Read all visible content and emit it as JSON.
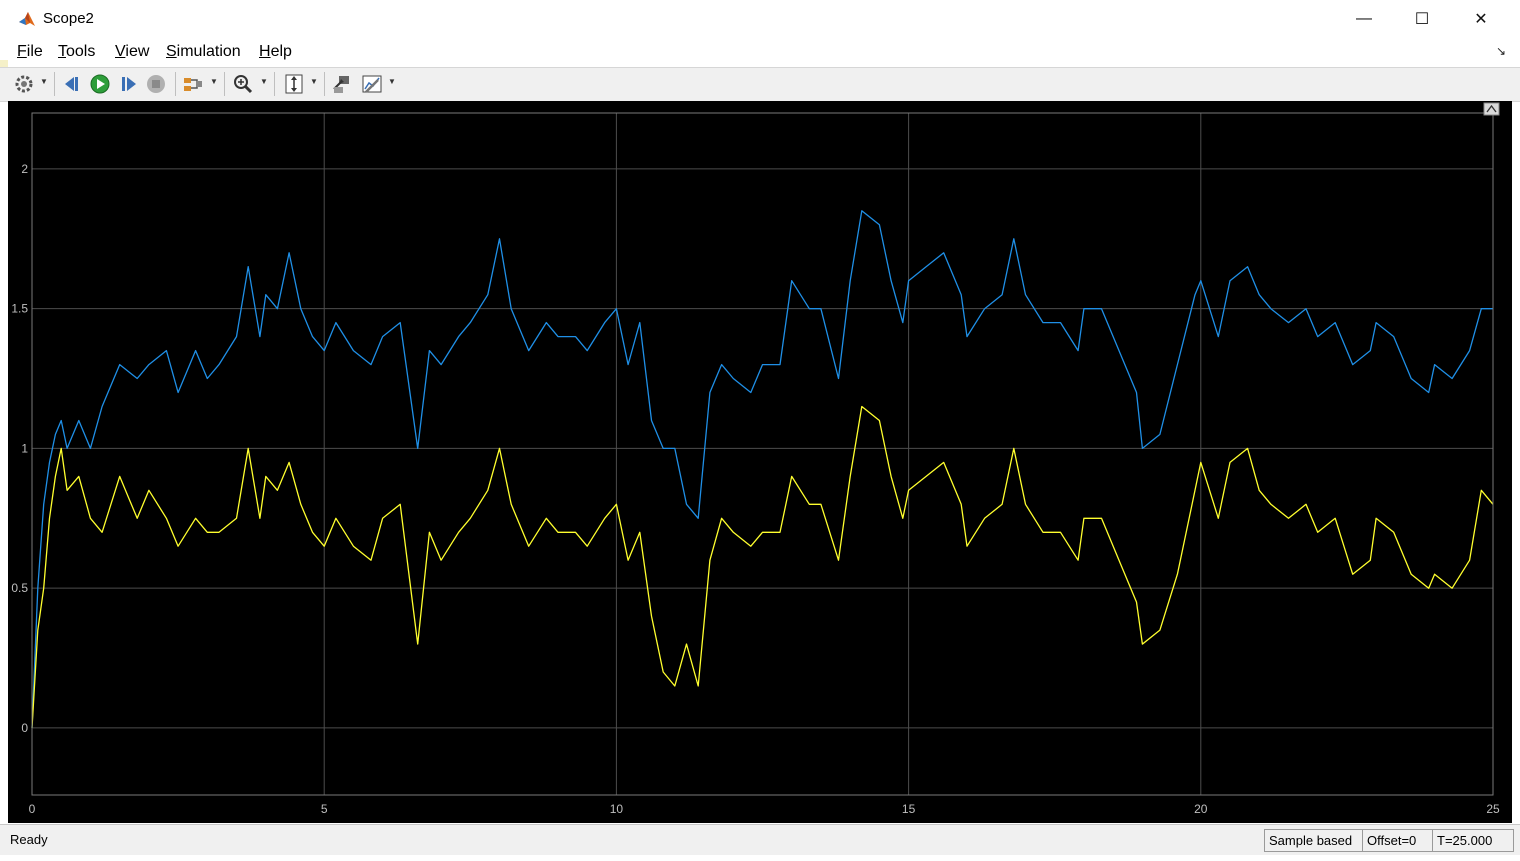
{
  "window": {
    "title": "Scope2",
    "minimize_glyph": "—",
    "maximize_glyph": "☐",
    "close_glyph": "✕"
  },
  "menu": [
    {
      "label": "File",
      "mnemonic": "F",
      "rest": "ile"
    },
    {
      "label": "Tools",
      "mnemonic": "T",
      "rest": "ools"
    },
    {
      "label": "View",
      "mnemonic": "V",
      "rest": "iew"
    },
    {
      "label": "Simulation",
      "mnemonic": "S",
      "rest": "imulation"
    },
    {
      "label": "Help",
      "mnemonic": "H",
      "rest": "elp"
    }
  ],
  "toolbar": {
    "items": [
      "settings-icon",
      "step-back-icon",
      "run-icon",
      "step-forward-icon",
      "stop-icon",
      "signal-select-icon",
      "zoom-in-icon",
      "autoscale-icon",
      "highlight-block-icon",
      "style-edit-icon"
    ]
  },
  "colors": {
    "plot_bg": "#000000",
    "axes_bg": "#000000",
    "grid": "#4d4d4d",
    "tick_text": "#bfbfbf",
    "series1": "#1f8fe6",
    "series2": "#ffff2e"
  },
  "chart_data": {
    "type": "line",
    "title": "",
    "xlabel": "",
    "ylabel": "",
    "xlim": [
      0,
      25
    ],
    "ylim": [
      -0.24,
      2.2
    ],
    "xticks": [
      "0",
      "5",
      "10",
      "15",
      "20",
      "25"
    ],
    "yticks": [
      "0",
      "0.5",
      "1",
      "1.5",
      "2"
    ],
    "grid": true,
    "series": [
      {
        "color": "#1f8fe6",
        "x": [
          0,
          0.1,
          0.2,
          0.3,
          0.4,
          0.5,
          0.6,
          0.8,
          1.0,
          1.2,
          1.5,
          1.8,
          2.0,
          2.3,
          2.5,
          2.8,
          3.0,
          3.2,
          3.5,
          3.7,
          3.9,
          4.0,
          4.2,
          4.4,
          4.6,
          4.8,
          5.0,
          5.2,
          5.5,
          5.8,
          6.0,
          6.3,
          6.6,
          6.8,
          7.0,
          7.3,
          7.5,
          7.8,
          8.0,
          8.2,
          8.5,
          8.8,
          9.0,
          9.3,
          9.5,
          9.8,
          10.0,
          10.2,
          10.4,
          10.6,
          10.8,
          11.0,
          11.2,
          11.4,
          11.6,
          11.8,
          12.0,
          12.3,
          12.5,
          12.8,
          13.0,
          13.3,
          13.5,
          13.8,
          14.0,
          14.2,
          14.5,
          14.7,
          14.9,
          15.0,
          15.3,
          15.6,
          15.9,
          16.0,
          16.3,
          16.6,
          16.8,
          17.0,
          17.3,
          17.6,
          17.9,
          18.0,
          18.3,
          18.6,
          18.9,
          19.0,
          19.3,
          19.6,
          19.9,
          20.0,
          20.3,
          20.5,
          20.8,
          21.0,
          21.2,
          21.5,
          21.8,
          22.0,
          22.3,
          22.6,
          22.9,
          23.0,
          23.3,
          23.6,
          23.9,
          24.0,
          24.3,
          24.6,
          24.8,
          25.0
        ],
        "y": [
          0.0,
          0.5,
          0.8,
          0.95,
          1.05,
          1.1,
          1.0,
          1.1,
          1.0,
          1.15,
          1.3,
          1.25,
          1.3,
          1.35,
          1.2,
          1.35,
          1.25,
          1.3,
          1.4,
          1.65,
          1.4,
          1.55,
          1.5,
          1.7,
          1.5,
          1.4,
          1.35,
          1.45,
          1.35,
          1.3,
          1.4,
          1.45,
          1.0,
          1.35,
          1.3,
          1.4,
          1.45,
          1.55,
          1.75,
          1.5,
          1.35,
          1.45,
          1.4,
          1.4,
          1.35,
          1.45,
          1.5,
          1.3,
          1.45,
          1.1,
          1.0,
          1.0,
          0.8,
          0.75,
          1.2,
          1.3,
          1.25,
          1.2,
          1.3,
          1.3,
          1.6,
          1.5,
          1.5,
          1.25,
          1.6,
          1.85,
          1.8,
          1.6,
          1.45,
          1.6,
          1.65,
          1.7,
          1.55,
          1.4,
          1.5,
          1.55,
          1.75,
          1.55,
          1.45,
          1.45,
          1.35,
          1.5,
          1.5,
          1.35,
          1.2,
          1.0,
          1.05,
          1.3,
          1.55,
          1.6,
          1.4,
          1.6,
          1.65,
          1.55,
          1.5,
          1.45,
          1.5,
          1.4,
          1.45,
          1.3,
          1.35,
          1.45,
          1.4,
          1.25,
          1.2,
          1.3,
          1.25,
          1.35,
          1.5,
          1.5
        ]
      },
      {
        "color": "#ffff2e",
        "x": [
          0,
          0.1,
          0.2,
          0.3,
          0.4,
          0.5,
          0.6,
          0.8,
          1.0,
          1.2,
          1.5,
          1.8,
          2.0,
          2.3,
          2.5,
          2.8,
          3.0,
          3.2,
          3.5,
          3.7,
          3.9,
          4.0,
          4.2,
          4.4,
          4.6,
          4.8,
          5.0,
          5.2,
          5.5,
          5.8,
          6.0,
          6.3,
          6.6,
          6.8,
          7.0,
          7.3,
          7.5,
          7.8,
          8.0,
          8.2,
          8.5,
          8.8,
          9.0,
          9.3,
          9.5,
          9.8,
          10.0,
          10.2,
          10.4,
          10.6,
          10.8,
          11.0,
          11.2,
          11.4,
          11.6,
          11.8,
          12.0,
          12.3,
          12.5,
          12.8,
          13.0,
          13.3,
          13.5,
          13.8,
          14.0,
          14.2,
          14.5,
          14.7,
          14.9,
          15.0,
          15.3,
          15.6,
          15.9,
          16.0,
          16.3,
          16.6,
          16.8,
          17.0,
          17.3,
          17.6,
          17.9,
          18.0,
          18.3,
          18.6,
          18.9,
          19.0,
          19.3,
          19.6,
          19.9,
          20.0,
          20.3,
          20.5,
          20.8,
          21.0,
          21.2,
          21.5,
          21.8,
          22.0,
          22.3,
          22.6,
          22.9,
          23.0,
          23.3,
          23.6,
          23.9,
          24.0,
          24.3,
          24.6,
          24.8,
          25.0
        ],
        "y": [
          0.0,
          0.35,
          0.5,
          0.75,
          0.9,
          1.0,
          0.85,
          0.9,
          0.75,
          0.7,
          0.9,
          0.75,
          0.85,
          0.75,
          0.65,
          0.75,
          0.7,
          0.7,
          0.75,
          1.0,
          0.75,
          0.9,
          0.85,
          0.95,
          0.8,
          0.7,
          0.65,
          0.75,
          0.65,
          0.6,
          0.75,
          0.8,
          0.3,
          0.7,
          0.6,
          0.7,
          0.75,
          0.85,
          1.0,
          0.8,
          0.65,
          0.75,
          0.7,
          0.7,
          0.65,
          0.75,
          0.8,
          0.6,
          0.7,
          0.4,
          0.2,
          0.15,
          0.3,
          0.15,
          0.6,
          0.75,
          0.7,
          0.65,
          0.7,
          0.7,
          0.9,
          0.8,
          0.8,
          0.6,
          0.9,
          1.15,
          1.1,
          0.9,
          0.75,
          0.85,
          0.9,
          0.95,
          0.8,
          0.65,
          0.75,
          0.8,
          1.0,
          0.8,
          0.7,
          0.7,
          0.6,
          0.75,
          0.75,
          0.6,
          0.45,
          0.3,
          0.35,
          0.55,
          0.85,
          0.95,
          0.75,
          0.95,
          1.0,
          0.85,
          0.8,
          0.75,
          0.8,
          0.7,
          0.75,
          0.55,
          0.6,
          0.75,
          0.7,
          0.55,
          0.5,
          0.55,
          0.5,
          0.6,
          0.85,
          0.8
        ]
      }
    ]
  },
  "status": {
    "left": "Ready",
    "sample_mode": "Sample based",
    "offset": "Offset=0",
    "time": "T=25.000"
  }
}
